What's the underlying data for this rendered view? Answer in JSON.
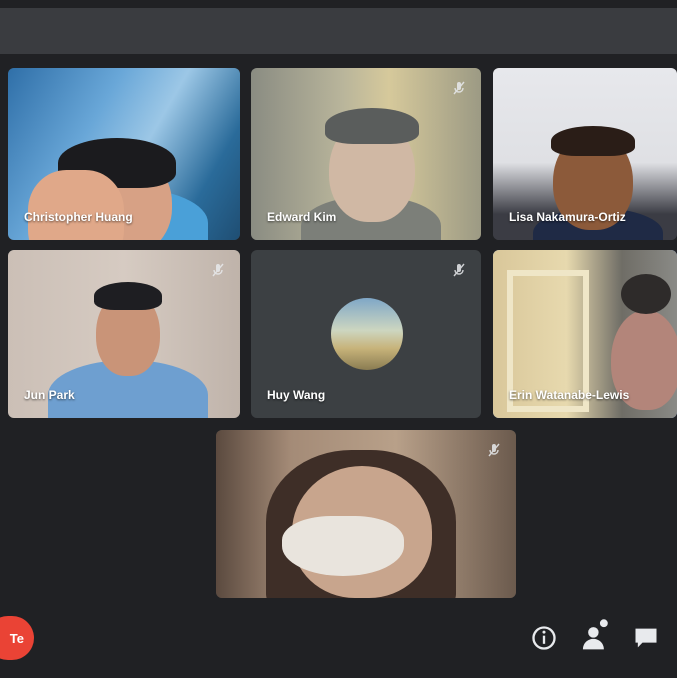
{
  "window": {
    "title": ""
  },
  "participants": [
    {
      "name": "Christopher Huang",
      "muted": true
    },
    {
      "name": "Edward Kim",
      "muted": true
    },
    {
      "name": "Lisa Nakamura-Ortiz",
      "muted": true
    },
    {
      "name": "Jun Park",
      "muted": true
    },
    {
      "name": "Huy Wang",
      "muted": true,
      "camera_off": true
    },
    {
      "name": "Erin Watanabe-Lewis",
      "muted": true
    },
    {
      "name": "",
      "muted": true
    }
  ],
  "controls": {
    "leave_label": "Te",
    "icons": [
      "info-icon",
      "people-icon",
      "chat-icon"
    ]
  },
  "colors": {
    "background": "#202124",
    "tile": "#3c4043",
    "leave": "#ea4335",
    "active_border": "#8ab4f8"
  }
}
